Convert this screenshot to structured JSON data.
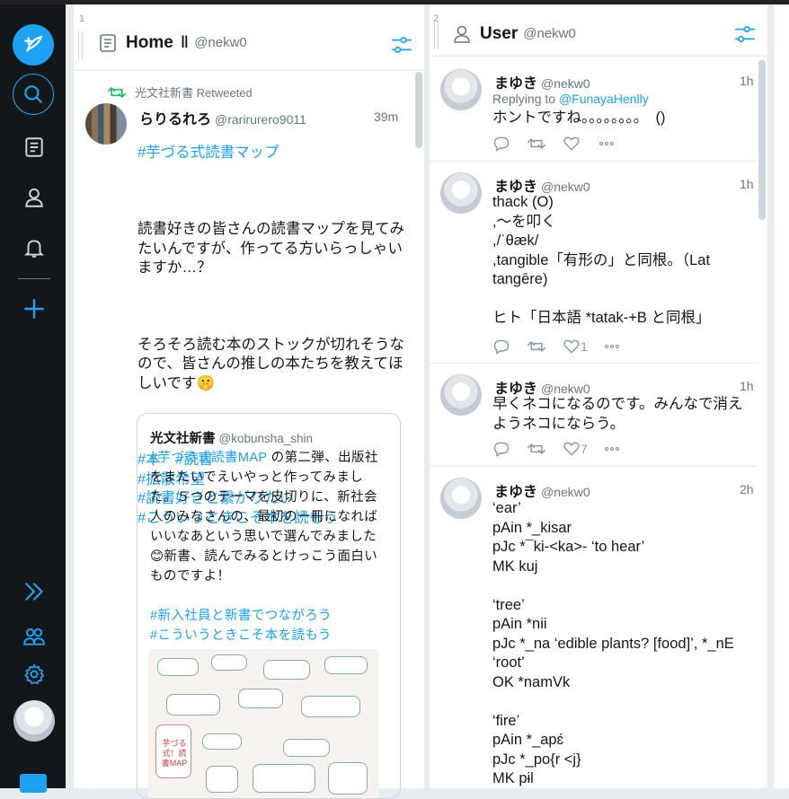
{
  "column1": {
    "number": "1",
    "title": "Home",
    "title_suffix": "Ⅱ",
    "handle": "@nekw0",
    "retweet_line": "光文社新書 Retweeted",
    "tweet": {
      "name": "らりるれろ",
      "handle": "@rarirurero9011",
      "time": "39m",
      "hashtag_top": "#芋づる式読書マップ",
      "paragraph1": "読書好きの皆さんの読書マップを見てみたいんですが、作ってる方いらっしゃいますか…？",
      "paragraph2": "そろそろ読む本のストックが切れそうなので、皆さんの推しの本たちを教えてほしいです🤫",
      "tags": "#本　#読書\n#拡散希望\n#読書好きと繋がりたい\n#こういうときこそ本を読もう"
    },
    "quote": {
      "name": "光文社新書",
      "handle": "@kobunsha_shin",
      "link": "#芋づる式読書MAP",
      "text": " の第二弾、出版社をまたいでえいやっと作ってみました。５つのテーマを皮切りに、新社会人のみなさんの、最初の一冊になればいいなあという思いで選んでみました😊新書、読んでみるとけっこう面白いものですよ！",
      "tags": "#新入社員と新書でつながろう\n#こういうときこそ本を読もう",
      "image_label": "芋づる式！読書MAP"
    }
  },
  "column2": {
    "number": "2",
    "title": "User",
    "handle": "@nekw0",
    "tweets": [
      {
        "name": "まゆき",
        "handle": "@nekw0",
        "time": "1h",
        "reply_prefix": "Replying to ",
        "reply_to": "@FunayaHenlly",
        "text": "ホントですね。。。。。。。。　()",
        "likes": ""
      },
      {
        "name": "まゆき",
        "handle": "@nekw0",
        "time": "1h",
        "text": "thack (O)\n,～を叩く\n,/ˈθæk/\n,tangible「有形の」と同根。（Lat tangēre)\n\nヒト「日本語 *tatak-+B と同根」",
        "likes": "1"
      },
      {
        "name": "まゆき",
        "handle": "@nekw0",
        "time": "1h",
        "text": "早くネコになるのです。みんなで消えようネコにならう。",
        "likes": "7"
      },
      {
        "name": "まゆき",
        "handle": "@nekw0",
        "time": "2h",
        "text": "‘ear’\npAin *_kisar\npJc *¯ki-<ka>- ‘to hear’\nMK kuj\n\n‘tree’\npAin *nii\npJc *_na ‘edible plants? [food]’, *_nE ‘root’\nOK *namVk\n\n‘fire’\npAin *_apɛ́\npJc *_po{r <j}\nMK pɨl",
        "likes": ""
      }
    ]
  },
  "icons": [
    "compose-icon",
    "search-icon",
    "home-column-icon",
    "user-icon",
    "notifications-icon",
    "add-icon",
    "expand-icon",
    "accounts-icon",
    "settings-icon",
    "twitter-logo"
  ],
  "colors": {
    "accent": "#1da1f2",
    "sidebar": "#14171a",
    "muted": "#657786",
    "border": "#e6ecf0"
  }
}
